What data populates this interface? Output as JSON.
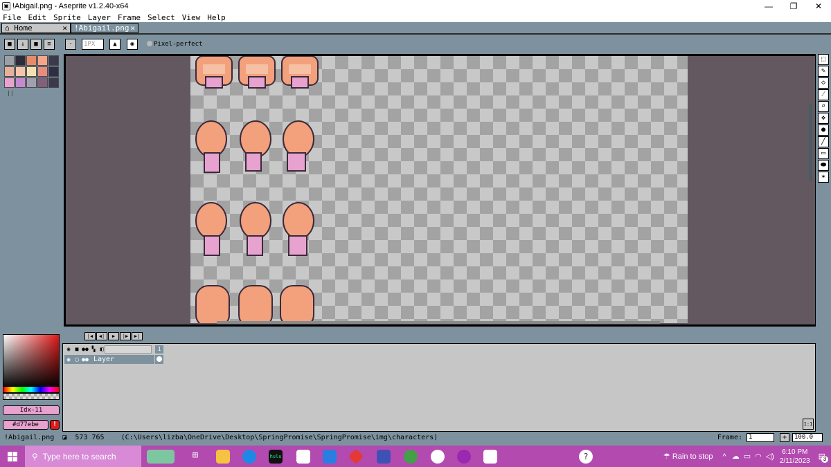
{
  "window": {
    "title": "!Abigail.png - Aseprite v1.2.40-x64",
    "minimize_glyph": "—",
    "restore_glyph": "❐",
    "close_glyph": "✕"
  },
  "menu": [
    "File",
    "Edit",
    "Sprite",
    "Layer",
    "Frame",
    "Select",
    "View",
    "Help"
  ],
  "tabs": [
    {
      "label": "Home",
      "icon": "home-icon"
    },
    {
      "label": "!Abigail.png",
      "active": true
    }
  ],
  "toolbar": {
    "brush_size": "1PX",
    "pixel_perfect_label": "Pixel-perfect"
  },
  "palette_colors": [
    "#9aa0a8",
    "#2b2b3a",
    "#e88a6a",
    "#f5a58a",
    "#3a3a4e",
    "#e8b09a",
    "#f6c4aa",
    "#f3e0b0",
    "#e88b80",
    "#2e2e44",
    "#e7a2d0",
    "#c48ad0",
    "#a0a0b0",
    "#80607a"
  ],
  "color": {
    "index_label": "Idx-11",
    "hex_label": "#d77ebe",
    "accent": "#e7a2d0"
  },
  "timeline": {
    "frame_number": "1",
    "layer_name": "Layer",
    "ratio_label": "1:1"
  },
  "status": {
    "filename": "!Abigail.png",
    "dimensions": "573 765",
    "path": "(C:\\Users\\lizba\\OneDrive\\Desktop\\SpringPromise\\SpringPromise\\img\\characters)",
    "frame_label": "Frame:",
    "frame_value": "1",
    "zoom_value": "100.0"
  },
  "taskbar": {
    "search_placeholder": "Type here to search",
    "hulu_label": "hulu",
    "weather": "Rain to stop",
    "time": "6:10 PM",
    "date": "2/11/2023",
    "notification_count": "3"
  }
}
